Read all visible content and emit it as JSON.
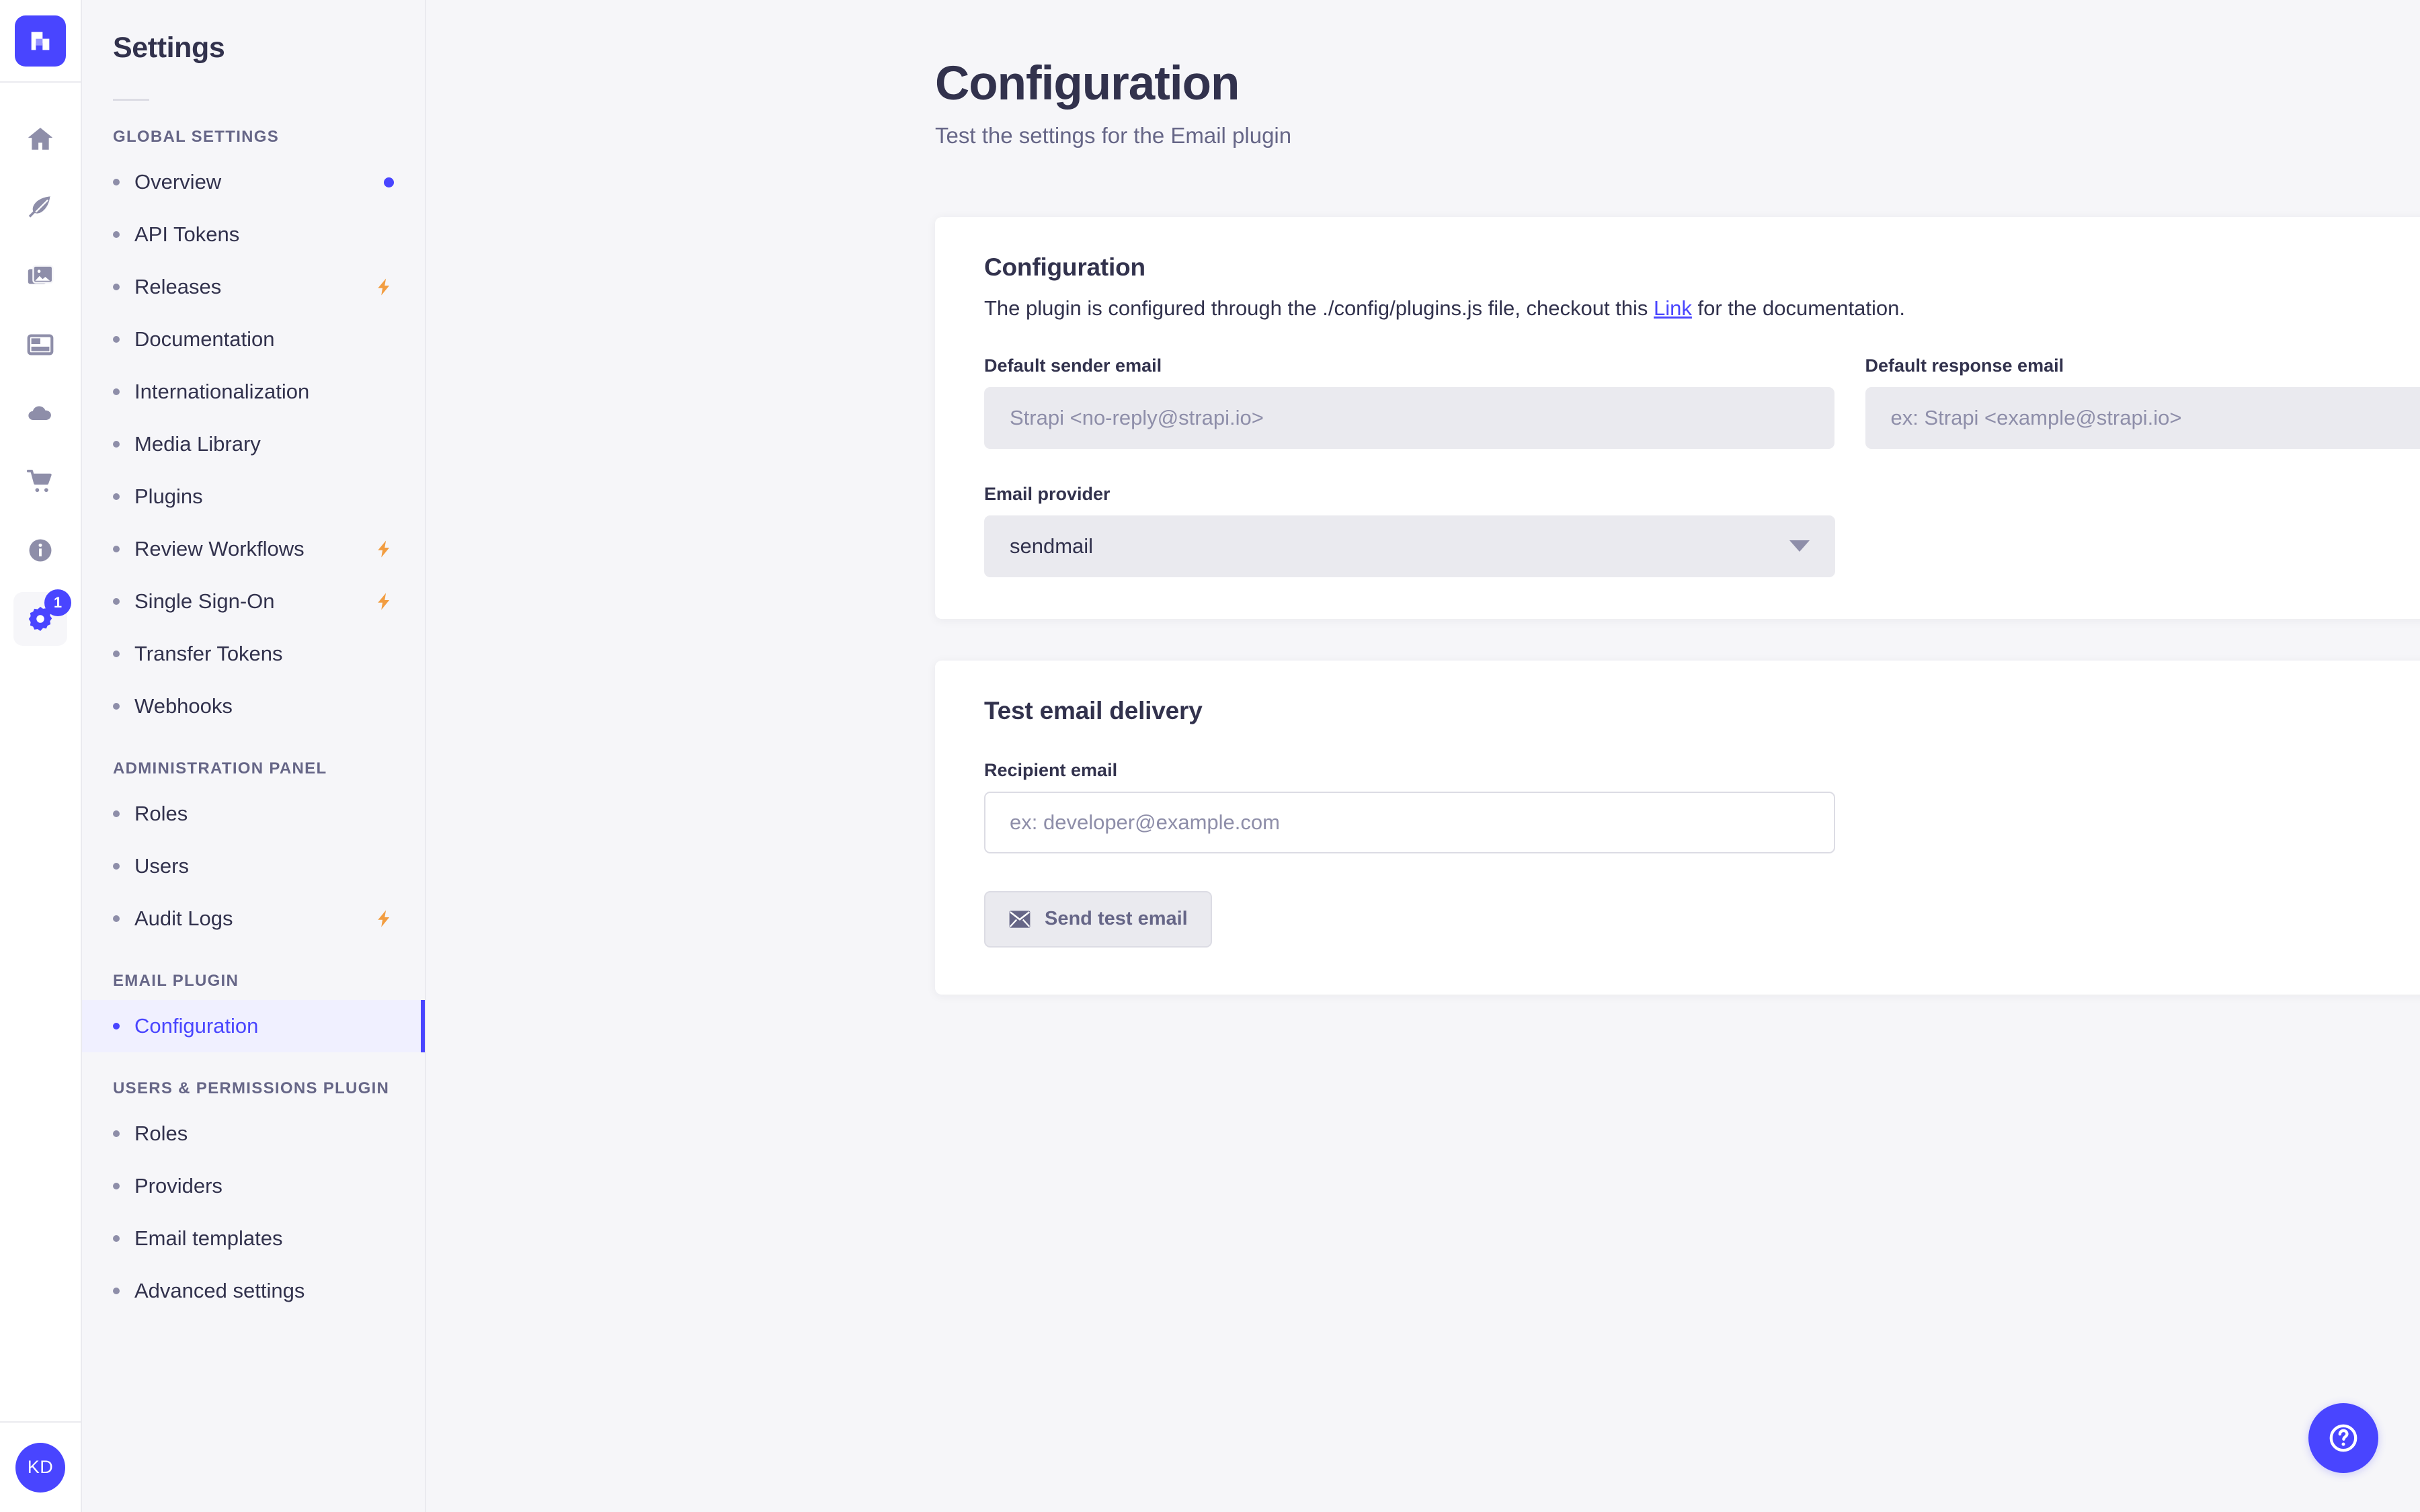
{
  "brand": {
    "logo_icon": "strapi-logo-icon",
    "accent_color": "#4945ff",
    "page_background": "#f6f6f9",
    "card_background": "#ffffff",
    "premium_badge_color": "#f29d41"
  },
  "rail": {
    "items": [
      {
        "icon": "home-icon",
        "name": "home"
      },
      {
        "icon": "feather-icon",
        "name": "content-manager"
      },
      {
        "icon": "images-icon",
        "name": "media-library"
      },
      {
        "icon": "layout-icon",
        "name": "content-type-builder"
      },
      {
        "icon": "cloud-icon",
        "name": "cloud"
      },
      {
        "icon": "shopping-cart-icon",
        "name": "marketplace"
      },
      {
        "icon": "info-circle-icon",
        "name": "information"
      },
      {
        "icon": "gear-icon",
        "name": "settings",
        "active": true,
        "badge": "1"
      }
    ],
    "avatar_initials": "KD"
  },
  "sidebar": {
    "title": "Settings",
    "sections": [
      {
        "label": "GLOBAL SETTINGS",
        "items": [
          {
            "label": "Overview",
            "trailing": "dot"
          },
          {
            "label": "API Tokens",
            "trailing": "none"
          },
          {
            "label": "Releases",
            "trailing": "bolt"
          },
          {
            "label": "Documentation",
            "trailing": "none"
          },
          {
            "label": "Internationalization",
            "trailing": "none"
          },
          {
            "label": "Media Library",
            "trailing": "none"
          },
          {
            "label": "Plugins",
            "trailing": "none"
          },
          {
            "label": "Review Workflows",
            "trailing": "bolt"
          },
          {
            "label": "Single Sign-On",
            "trailing": "bolt"
          },
          {
            "label": "Transfer Tokens",
            "trailing": "none"
          },
          {
            "label": "Webhooks",
            "trailing": "none"
          }
        ]
      },
      {
        "label": "ADMINISTRATION PANEL",
        "items": [
          {
            "label": "Roles",
            "trailing": "none"
          },
          {
            "label": "Users",
            "trailing": "none"
          },
          {
            "label": "Audit Logs",
            "trailing": "bolt"
          }
        ]
      },
      {
        "label": "EMAIL PLUGIN",
        "items": [
          {
            "label": "Configuration",
            "trailing": "none",
            "active": true
          }
        ]
      },
      {
        "label": "USERS & PERMISSIONS PLUGIN",
        "items": [
          {
            "label": "Roles",
            "trailing": "none"
          },
          {
            "label": "Providers",
            "trailing": "none"
          },
          {
            "label": "Email templates",
            "trailing": "none"
          },
          {
            "label": "Advanced settings",
            "trailing": "none"
          }
        ]
      }
    ]
  },
  "page": {
    "title": "Configuration",
    "subtitle": "Test the settings for the Email plugin"
  },
  "configuration_card": {
    "title": "Configuration",
    "description_before": "The plugin is configured through the ./config/plugins.js file, checkout this ",
    "link_text": "Link",
    "description_after": " for the documentation.",
    "sender_label": "Default sender email",
    "sender_placeholder": "Strapi <no-reply@strapi.io>",
    "sender_value": "",
    "response_label": "Default response email",
    "response_placeholder": "ex: Strapi <example@strapi.io>",
    "response_value": "",
    "provider_label": "Email provider",
    "provider_value": "sendmail",
    "provider_options": [
      "sendmail"
    ]
  },
  "test_card": {
    "title": "Test email delivery",
    "recipient_label": "Recipient email",
    "recipient_placeholder": "ex: developer@example.com",
    "recipient_value": "",
    "send_button_label": "Send test email",
    "send_button_icon": "envelope-icon"
  },
  "help": {
    "icon": "question-mark-circle-icon",
    "label": "Help"
  }
}
